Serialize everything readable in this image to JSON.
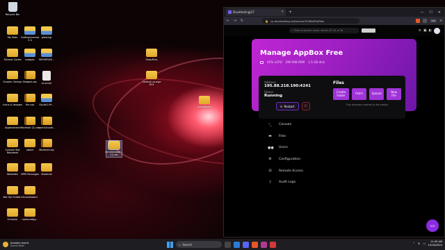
{
  "desktop": {
    "icons": [
      {
        "label": "Recycle Bin",
        "type": "bin"
      },
      {
        "label": "My Bots",
        "type": "folder"
      },
      {
        "label": "CodingLicense 2.0",
        "type": "img"
      },
      {
        "label": "plasting",
        "type": "img"
      },
      {
        "label": "Tutorial Codes",
        "type": "folder"
      },
      {
        "label": "badges",
        "type": "img"
      },
      {
        "label": "SERVERDE...",
        "type": "img"
      },
      {
        "label": "ShopFiles",
        "type": "folder"
      },
      {
        "label": "Graphic Design",
        "type": "folder"
      },
      {
        "label": "Badges.zip",
        "type": "zip"
      },
      {
        "label": "st.script",
        "type": "file"
      },
      {
        "label": "Coding Lounge GFX",
        "type": "folder"
      },
      {
        "label": "Icons & Images",
        "type": "folder"
      },
      {
        "label": "file.zip",
        "type": "zip"
      },
      {
        "label": "OAuth2-Pr...",
        "type": "img"
      },
      {
        "label": "Automate.it",
        "type": "folder"
      },
      {
        "label": "Applications",
        "type": "folder"
      },
      {
        "label": "Modmail (2).zip",
        "type": "zip"
      },
      {
        "label": "oauth2code...",
        "type": "zip"
      },
      {
        "label": "Custom Bot Requests",
        "type": "folder"
      },
      {
        "label": "zbdot",
        "type": "folder"
      },
      {
        "label": "Modmail.zip",
        "type": "zip"
      },
      {
        "label": "serveronstar...(1).nb",
        "type": "folder"
      },
      {
        "label": "Websites",
        "type": "folder"
      },
      {
        "label": "NPM Packages",
        "type": "folder"
      },
      {
        "label": "Modmail",
        "type": "folder"
      },
      {
        "label": "Bot Zip Folders",
        "type": "folder"
      },
      {
        "label": "Soundboard",
        "type": "folder"
      },
      {
        "label": "Scrap(s)",
        "type": "folder"
      },
      {
        "label": "npmpcatgy...",
        "type": "folder"
      }
    ]
  },
  "browser": {
    "tab_title": "DivaHosting|CF",
    "url": "cp.divahosting.net/server/3336ef54/files",
    "vpn_label": "VPN",
    "page": {
      "search_placeholder": "Enter a service name, server, IP, ID, or ⌘",
      "server_name": "Manage AppBox Free",
      "specs": [
        "45% vCPU",
        "296 MiB RAM",
        "1.5 GB disk"
      ],
      "address_label": "Address",
      "address_value": "195.88.218.190:4241",
      "status_label": "Status",
      "status_value": "Running",
      "restart_label": "Restart",
      "files_title": "Files",
      "file_buttons": [
        "Create Folder",
        "Fetch",
        "Upload",
        "New File"
      ],
      "empty_msg": "This directory seems to be empty.",
      "menu": [
        {
          "label": "Console",
          "icon": "terminal-icon",
          "glyph": "›_"
        },
        {
          "label": "Files",
          "icon": "folder-icon",
          "glyph": "▬"
        },
        {
          "label": "Users",
          "icon": "users-icon",
          "glyph": "●●"
        },
        {
          "label": "Configuration",
          "icon": "gears-icon",
          "glyph": "⚙"
        },
        {
          "label": "Remote Access",
          "icon": "network-icon",
          "glyph": "⊟"
        },
        {
          "label": "Audit Logs",
          "icon": "help-icon",
          "glyph": "?"
        }
      ]
    }
  },
  "taskbar": {
    "news_title": "Industry event",
    "news_sub": "Event brief",
    "search_label": "Search",
    "time": "11:49 AM",
    "date": "10/18/2024"
  },
  "colors": {
    "banner": "#c026d3",
    "accent": "#a034d8"
  }
}
